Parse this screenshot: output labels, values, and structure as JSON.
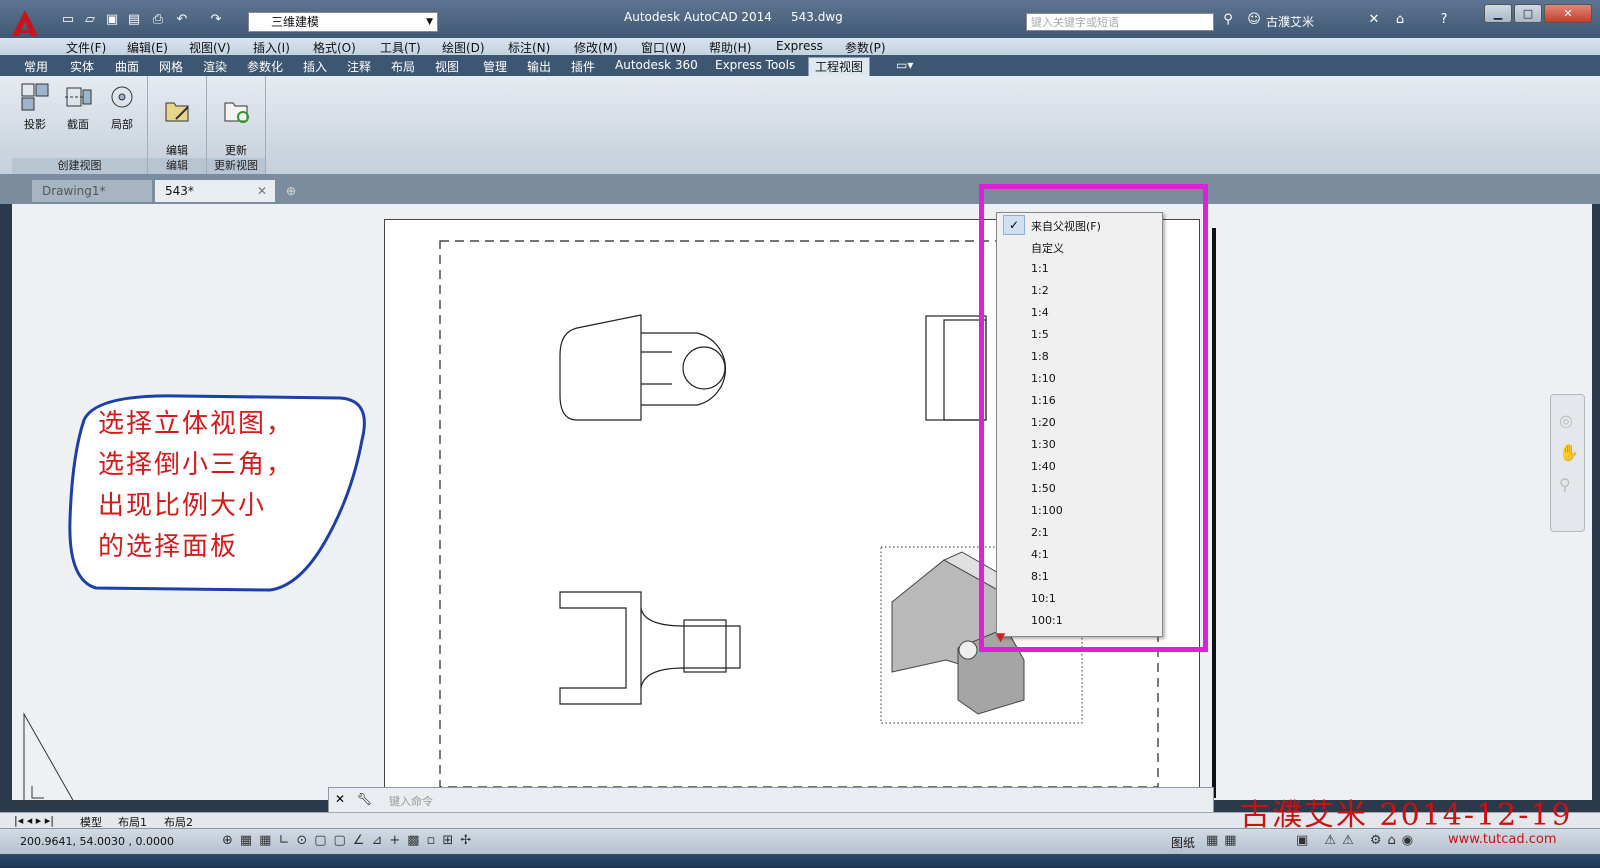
{
  "window": {
    "title": "Autodesk AutoCAD 2014",
    "file": "543.dwg",
    "workspace": "三维建模",
    "search_placeholder": "键入关键字或短语",
    "user": "古濮艾米"
  },
  "menu": [
    "文件(F)",
    "编辑(E)",
    "视图(V)",
    "插入(I)",
    "格式(O)",
    "工具(T)",
    "绘图(D)",
    "标注(N)",
    "修改(M)",
    "窗口(W)",
    "帮助(H)",
    "Express",
    "参数(P)"
  ],
  "ribbon_tabs": [
    "常用",
    "实体",
    "曲面",
    "网格",
    "渲染",
    "参数化",
    "插入",
    "注释",
    "布局",
    "视图",
    "管理",
    "输出",
    "插件",
    "Autodesk 360",
    "Express Tools",
    "工程视图"
  ],
  "ribbon": {
    "groups": [
      {
        "label": "创建视图",
        "buttons": [
          "投影",
          "截面",
          "局部"
        ]
      },
      {
        "label": "编辑",
        "buttons": [
          "编辑\n视图"
        ]
      },
      {
        "label": "更新视图",
        "buttons": [
          "更新\n视图"
        ]
      }
    ]
  },
  "file_tabs": [
    "Drawing1*",
    "543*"
  ],
  "callout": {
    "lines": [
      "选择立体视图，",
      "选择倒小三角，",
      "出现比例大小",
      "的选择面板"
    ]
  },
  "scale_menu": {
    "checked_index": 0,
    "items": [
      "来自父视图(F)",
      "自定义",
      "1:1",
      "1:2",
      "1:4",
      "1:5",
      "1:8",
      "1:10",
      "1:16",
      "1:20",
      "1:30",
      "1:40",
      "1:50",
      "1:100",
      "2:1",
      "4:1",
      "8:1",
      "10:1",
      "100:1"
    ]
  },
  "command_line": {
    "placeholder": "键入命令"
  },
  "layout_tabs": [
    "模型",
    "布局1",
    "布局2"
  ],
  "status": {
    "coords": "200.9641, 54.0030 , 0.0000",
    "space": "图纸"
  },
  "watermark": {
    "text": "古濮艾米 2014-12-19",
    "site": "www.tutcad.com"
  },
  "colors": {
    "highlight": "#e020d8",
    "callout_text": "#d61a1a",
    "callout_border": "#1c3fa8"
  }
}
